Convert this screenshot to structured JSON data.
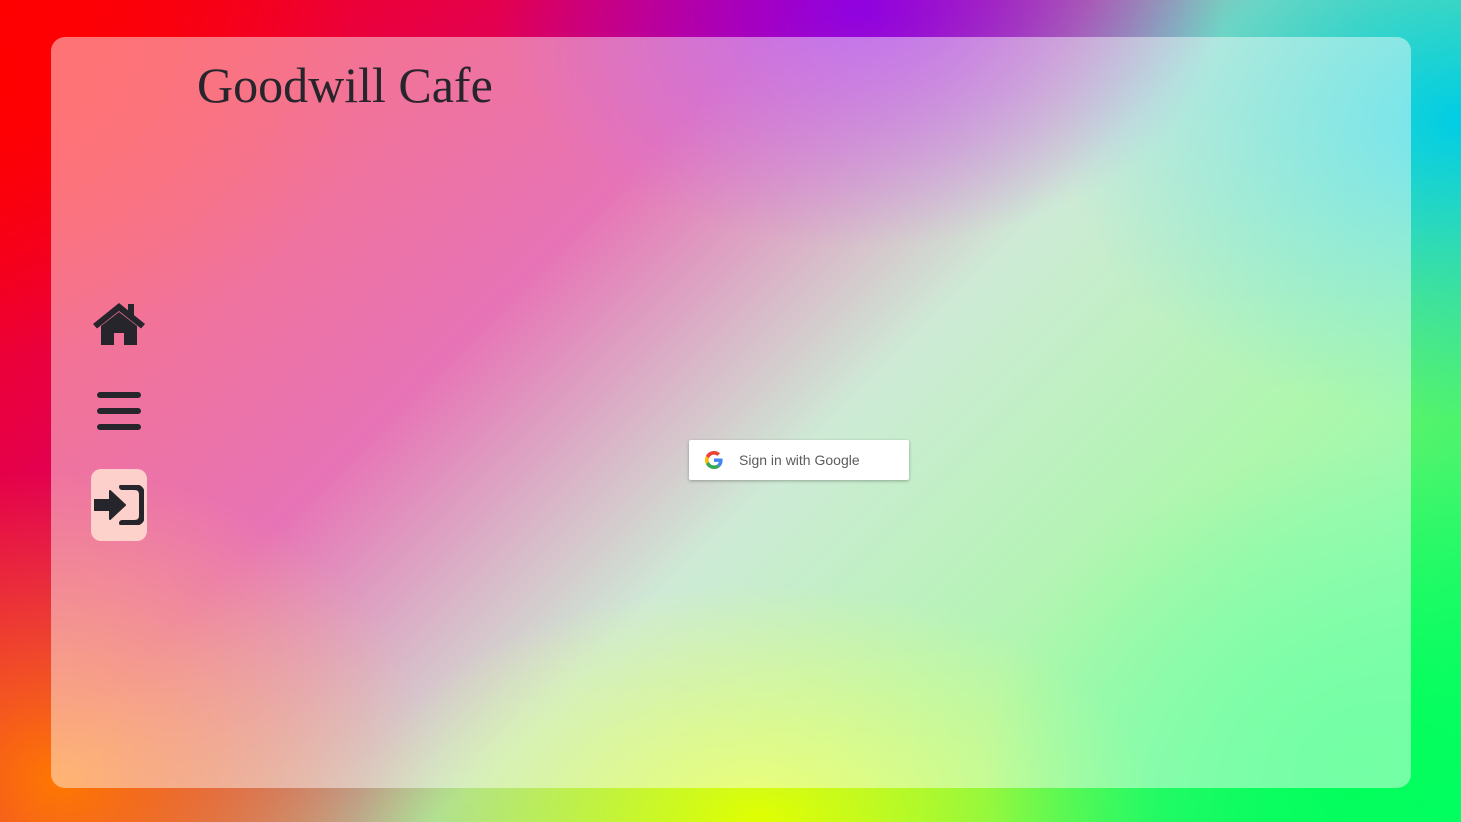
{
  "app": {
    "title": "Goodwill Cafe"
  },
  "nav": {
    "items": [
      {
        "icon": "home-icon",
        "active": false
      },
      {
        "icon": "menu-icon",
        "active": false
      },
      {
        "icon": "sign-in-icon",
        "active": true
      }
    ]
  },
  "signin": {
    "google_label": "Sign in with Google"
  },
  "colors": {
    "text_dark": "#26252b",
    "active_nav_bg": "#ffe1d2",
    "google_blue": "#4285F4",
    "google_red": "#EA4335",
    "google_yellow": "#FBBC05",
    "google_green": "#34A853"
  }
}
